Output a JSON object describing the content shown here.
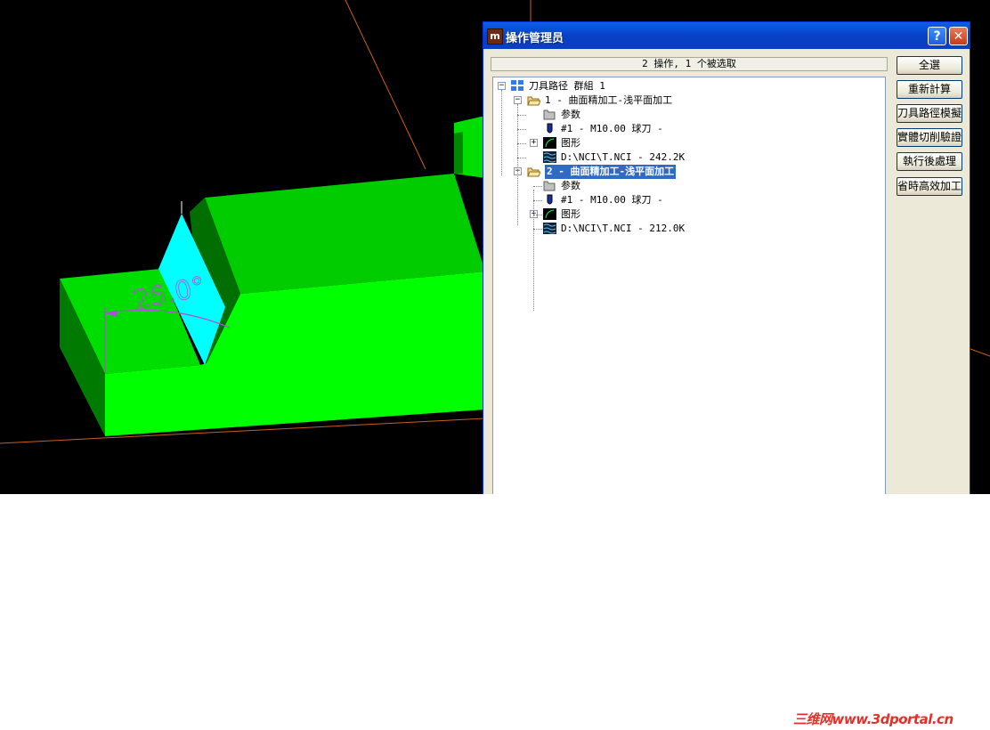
{
  "viewport": {
    "angle_label": "25.0°"
  },
  "dialog": {
    "title": "操作管理员",
    "help_glyph": "?",
    "close_glyph": "✕",
    "status_text": "2 操作, 1 个被选取",
    "tree": [
      {
        "label": "刀具路径 群組 1",
        "icon": "group-grid-icon",
        "expander": "⊟"
      },
      {
        "label": "1 - 曲面精加工-浅平面加工",
        "icon": "open-folder-icon",
        "expander": "⊟"
      },
      {
        "label": "参数",
        "icon": "folder-icon"
      },
      {
        "label": "#1 - M10.00 球刀 -",
        "icon": "ball-tool-icon"
      },
      {
        "label": "图形",
        "icon": "geometry-icon",
        "expander": "⊞"
      },
      {
        "label": "D:\\NCI\\T.NCI - 242.2K",
        "icon": "toolpath-wave-icon"
      },
      {
        "label": "2 - 曲面精加工-浅平面加工",
        "icon": "open-folder-icon",
        "expander": "⊟",
        "selected": true
      },
      {
        "label": "参数",
        "icon": "folder-icon"
      },
      {
        "label": "#1 - M10.00 球刀 -",
        "icon": "ball-tool-icon"
      },
      {
        "label": "图形",
        "icon": "geometry-icon",
        "expander": "⊞"
      },
      {
        "label": "D:\\NCI\\T.NCI - 212.0K",
        "icon": "toolpath-wave-icon"
      }
    ],
    "buttons": [
      "全選",
      "重新計算",
      "刀具路徑模擬",
      "實體切削驗證",
      "執行後處理",
      "省時高效加工"
    ]
  },
  "watermark": "三维网www.3dportal.cn",
  "colors": {
    "viewport_bg": "#000000",
    "part_green": "#00ff00",
    "fixture_cyan": "#00ffff",
    "dimension_purple": "#b04fd8",
    "axis_orange": "#c8601e",
    "titlebar_blue": "#0a5fe8",
    "selection": "#316ac5"
  }
}
